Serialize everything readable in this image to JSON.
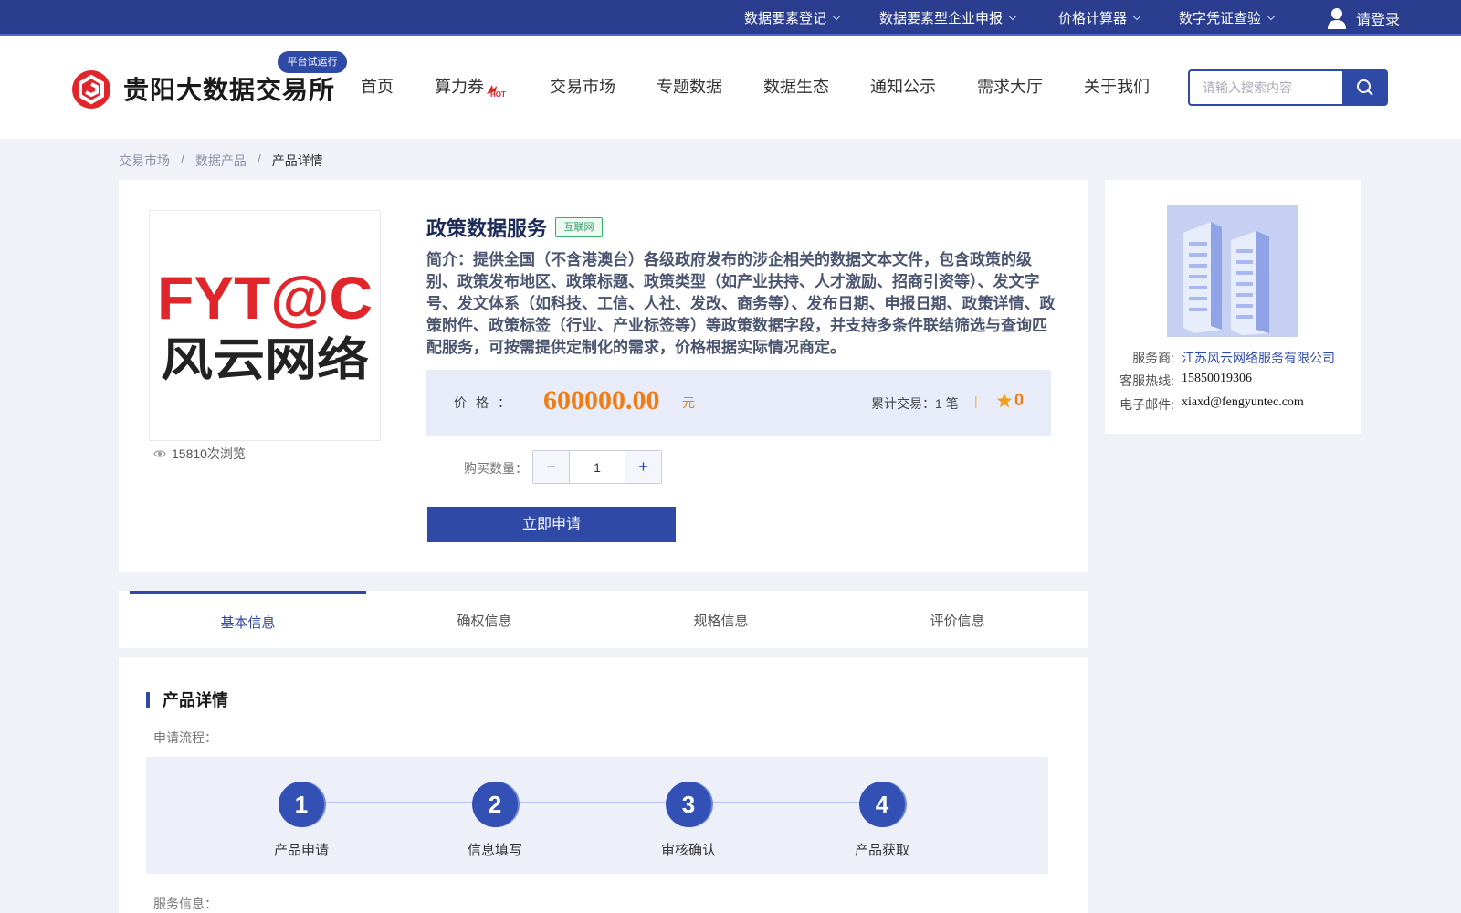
{
  "top_nav": [
    {
      "label": "数据要素登记"
    },
    {
      "label": "数据要素型企业申报"
    },
    {
      "label": "价格计算器"
    },
    {
      "label": "数字凭证查验"
    }
  ],
  "login_label": "请登录",
  "brand": {
    "name": "贵阳大数据交易所",
    "badge": "平台试运行"
  },
  "main_nav": [
    "首页",
    "算力券",
    "交易市场",
    "专题数据",
    "数据生态",
    "通知公示",
    "需求大厅",
    "关于我们"
  ],
  "hot_label": "HOT",
  "search": {
    "placeholder": "请输入搜索内容"
  },
  "breadcrumb": [
    "交易市场",
    "/",
    "数据产品",
    "/",
    "产品详情"
  ],
  "product": {
    "logo_text_top": "FYT@C",
    "logo_text_bottom": "风云网络",
    "views": "15810次浏览",
    "title": "政策数据服务",
    "tag": "互联网",
    "description": "简介：提供全国（不含港澳台）各级政府发布的涉企相关的数据文本文件，包含政策的级别、政策发布地区、政策标题、政策类型（如产业扶持、人才激励、招商引资等）、发文字号、发文体系（如科技、工信、人社、发改、商务等）、发布日期、申报日期、政策详情、政策附件、政策标签（行业、产业标签等）等政策数据字段，并支持多条件联结筛选与查询匹配服务，可按需提供定制化的需求，价格根据实际情况商定。",
    "price_label": "价格：",
    "price": "600000.00",
    "price_unit": "元",
    "trades": "累计交易：1 笔",
    "separator": "|",
    "stars": "0",
    "qty_label": "购买数量：",
    "qty_minus": "−",
    "qty_value": "1",
    "qty_plus": "+",
    "apply_button": "立即申请"
  },
  "provider": {
    "service_label": "服务商:",
    "service_value": "江苏风云网络服务有限公司",
    "hotline_label": "客服热线:",
    "hotline_value": "15850019306",
    "email_label": "电子邮件:",
    "email_value": "xiaxd@fengyuntec.com"
  },
  "tabs": [
    {
      "label": "基本信息",
      "active": true
    },
    {
      "label": "确权信息"
    },
    {
      "label": "规格信息"
    },
    {
      "label": "评价信息"
    }
  ],
  "detail": {
    "title": "产品详情",
    "process_label": "申请流程：",
    "steps": [
      {
        "num": "1",
        "label": "产品申请"
      },
      {
        "num": "2",
        "label": "信息填写"
      },
      {
        "num": "3",
        "label": "审核确认"
      },
      {
        "num": "4",
        "label": "产品获取"
      }
    ],
    "service_info_label": "服务信息："
  },
  "colors": {
    "primary": "#2f49a6",
    "topbar": "#2a3d8f",
    "price": "#f07d14",
    "tag": "#2ea062",
    "logo_red": "#e0262b"
  }
}
